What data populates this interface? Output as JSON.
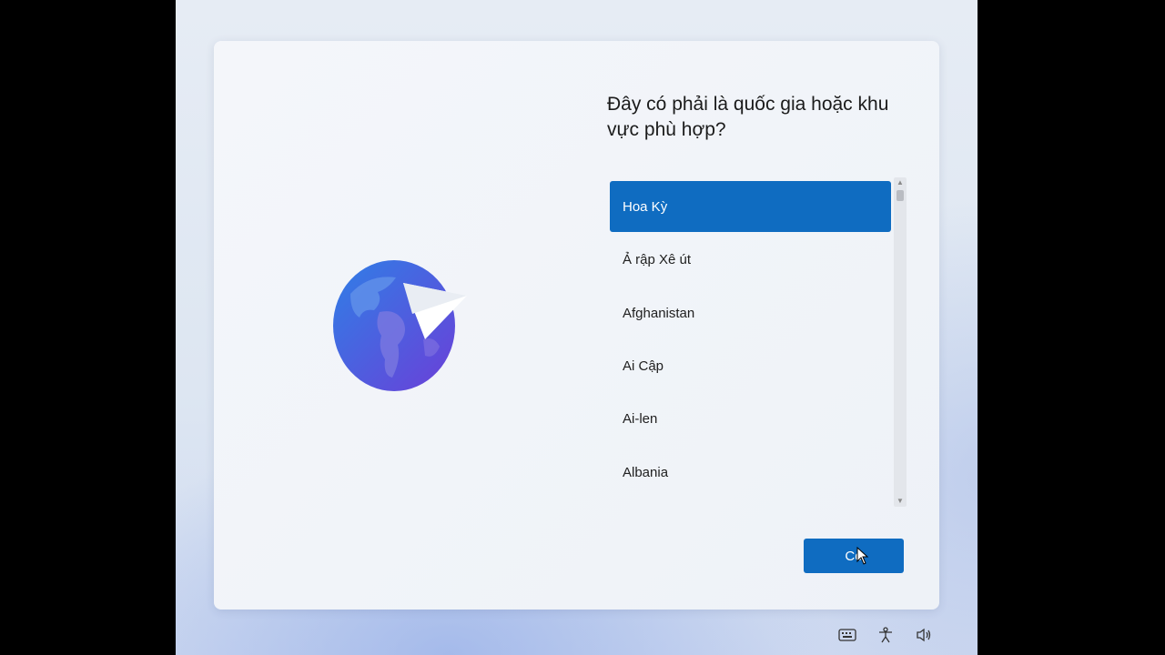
{
  "page": {
    "question": "Đây có phải là quốc gia hoặc khu vực phù hợp?"
  },
  "regions": {
    "items": [
      "Hoa Kỳ",
      "Ả rập Xê út",
      "Afghanistan",
      "Ai Cập",
      "Ai-len",
      "Albania"
    ],
    "selected_index": 0
  },
  "actions": {
    "next_label": "Có"
  },
  "tray": {
    "icons": [
      "keyboard-icon",
      "accessibility-icon",
      "volume-icon"
    ]
  },
  "colors": {
    "accent": "#0f6cc1",
    "card_background": "#f2f4f8",
    "text": "#1b1b1b"
  }
}
